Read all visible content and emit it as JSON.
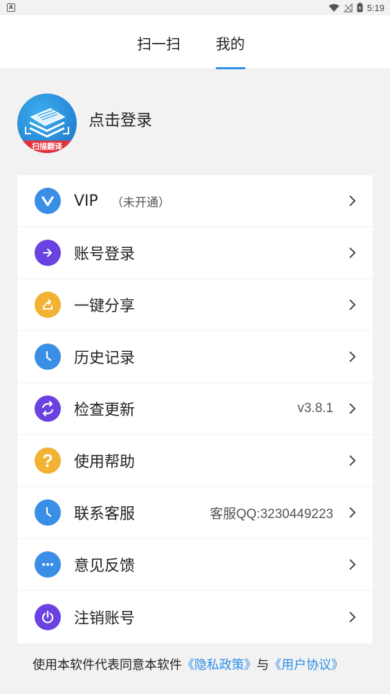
{
  "status_bar": {
    "time": "5:19",
    "icons": [
      "app-notification-icon",
      "wifi-icon",
      "no-signal-icon",
      "battery-icon"
    ]
  },
  "tabs": [
    {
      "label": "扫一扫",
      "active": false
    },
    {
      "label": "我的",
      "active": true
    }
  ],
  "profile": {
    "avatar_label": "扫描翻译",
    "login_text": "点击登录"
  },
  "menu": [
    {
      "label": "VIP",
      "sub": "（未开通）",
      "value": "",
      "icon": "vip-icon",
      "color": "#3b8ee6"
    },
    {
      "label": "账号登录",
      "sub": "",
      "value": "",
      "icon": "login-arrow-icon",
      "color": "#6a42e0"
    },
    {
      "label": "一键分享",
      "sub": "",
      "value": "",
      "icon": "share-icon",
      "color": "#f2b233"
    },
    {
      "label": "历史记录",
      "sub": "",
      "value": "",
      "icon": "clock-icon",
      "color": "#3b8ee6"
    },
    {
      "label": "检查更新",
      "sub": "",
      "value": "v3.8.1",
      "icon": "refresh-icon",
      "color": "#6a42e0"
    },
    {
      "label": "使用帮助",
      "sub": "",
      "value": "",
      "icon": "help-icon",
      "color": "#f2b233"
    },
    {
      "label": "联系客服",
      "sub": "",
      "value": "客服QQ:3230449223",
      "icon": "clock-icon",
      "color": "#3b8ee6"
    },
    {
      "label": "意见反馈",
      "sub": "",
      "value": "",
      "icon": "chat-bubble-icon",
      "color": "#3b8ee6"
    },
    {
      "label": "注销账号",
      "sub": "",
      "value": "",
      "icon": "power-icon",
      "color": "#6a42e0"
    }
  ],
  "footer": {
    "prefix": "使用本软件代表同意本软件",
    "privacy_link": "《隐私政策》",
    "conjunction": "与",
    "agreement_link": "《用户协议》"
  },
  "colors": {
    "accent": "#2a8ee8",
    "background": "#f2f2f2",
    "card": "#ffffff"
  }
}
